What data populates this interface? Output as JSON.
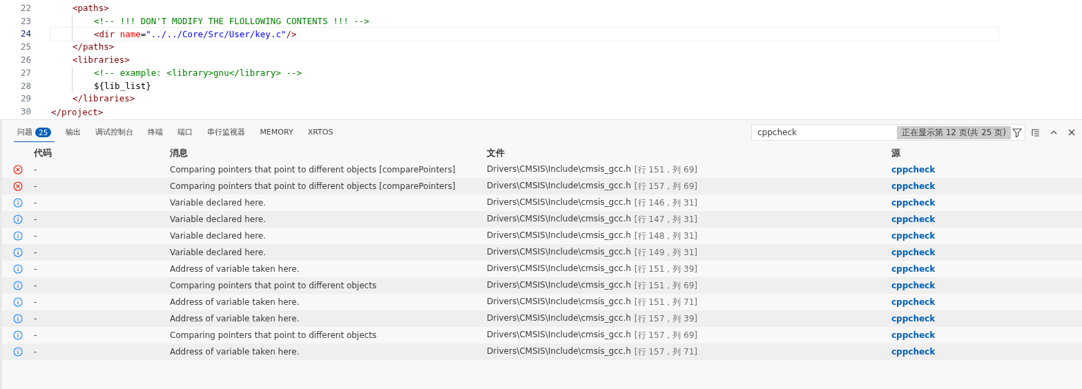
{
  "editor": {
    "lines": [
      {
        "children": [
          {
            "number": "22",
            "current": false,
            "tokens": [
              {
                "kind": "tag",
                "text": "<paths>"
              }
            ],
            "children": [
              {
                "number": "23",
                "current": false,
                "tokens": [
                  {
                    "kind": "comment",
                    "text": "<!-- !!! DON'T MODIFY THE FLOLLOWING CONTENTS !!! -->"
                  }
                ]
              },
              {
                "number": "24",
                "current": true,
                "tokens": [
                  {
                    "kind": "tag",
                    "text": "<dir "
                  },
                  {
                    "kind": "attr",
                    "text": "name"
                  },
                  {
                    "kind": "text",
                    "text": "="
                  },
                  {
                    "kind": "string",
                    "text": "\"../../Core/Src/User/key.c\""
                  },
                  {
                    "kind": "tag",
                    "text": "/>"
                  }
                ]
              }
            ]
          },
          {
            "number": "25",
            "current": false,
            "tokens": [
              {
                "kind": "tag",
                "text": "</paths>"
              }
            ]
          },
          {
            "number": "26",
            "current": false,
            "tokens": [
              {
                "kind": "tag",
                "text": "<libraries>"
              }
            ],
            "children": [
              {
                "number": "27",
                "current": false,
                "tokens": [
                  {
                    "kind": "comment",
                    "text": "<!-- example: <library>gnu</library> -->"
                  }
                ]
              },
              {
                "number": "28",
                "current": false,
                "tokens": [
                  {
                    "kind": "text",
                    "text": "${lib_list}"
                  }
                ]
              }
            ]
          },
          {
            "number": "29",
            "current": false,
            "tokens": [
              {
                "kind": "tag",
                "text": "</libraries>"
              }
            ]
          }
        ]
      },
      {
        "number": "30",
        "current": false,
        "tokens": [
          {
            "kind": "tag",
            "text": "</project>"
          }
        ]
      }
    ]
  },
  "panel": {
    "tabs": [
      {
        "label": "问题",
        "badge": "25",
        "selected": true
      },
      {
        "label": "输出",
        "selected": false
      },
      {
        "label": "调试控制台",
        "selected": false
      },
      {
        "label": "终端",
        "selected": false
      },
      {
        "label": "端口",
        "selected": false
      },
      {
        "label": "串行监视器",
        "selected": false
      },
      {
        "label": "MEMORY",
        "selected": false
      },
      {
        "label": "XRTOS",
        "selected": false
      }
    ],
    "filter": {
      "value": "cppcheck",
      "page_info": "正在显示第 12 页(共 25 页)"
    },
    "table": {
      "columns": [
        "代码",
        "消息",
        "文件",
        "源"
      ],
      "rows": [
        {
          "kind": "error",
          "code": "-",
          "message": "Comparing pointers that point to different objects [comparePointers]",
          "file": "Drivers\\CMSIS\\Include\\cmsis_gcc.h",
          "location": "[行 151，列 69]",
          "source": "cppcheck"
        },
        {
          "kind": "error",
          "code": "-",
          "message": "Comparing pointers that point to different objects [comparePointers]",
          "file": "Drivers\\CMSIS\\Include\\cmsis_gcc.h",
          "location": "[行 157，列 69]",
          "source": "cppcheck"
        },
        {
          "kind": "info",
          "code": "-",
          "message": "Variable declared here.",
          "file": "Drivers\\CMSIS\\Include\\cmsis_gcc.h",
          "location": "[行 146，列 31]",
          "source": "cppcheck"
        },
        {
          "kind": "info",
          "code": "-",
          "message": "Variable declared here.",
          "file": "Drivers\\CMSIS\\Include\\cmsis_gcc.h",
          "location": "[行 147，列 31]",
          "source": "cppcheck"
        },
        {
          "kind": "info",
          "code": "-",
          "message": "Variable declared here.",
          "file": "Drivers\\CMSIS\\Include\\cmsis_gcc.h",
          "location": "[行 148，列 31]",
          "source": "cppcheck"
        },
        {
          "kind": "info",
          "code": "-",
          "message": "Variable declared here.",
          "file": "Drivers\\CMSIS\\Include\\cmsis_gcc.h",
          "location": "[行 149，列 31]",
          "source": "cppcheck"
        },
        {
          "kind": "info",
          "code": "-",
          "message": "Address of variable taken here.",
          "file": "Drivers\\CMSIS\\Include\\cmsis_gcc.h",
          "location": "[行 151，列 39]",
          "source": "cppcheck"
        },
        {
          "kind": "info",
          "code": "-",
          "message": "Comparing pointers that point to different objects",
          "file": "Drivers\\CMSIS\\Include\\cmsis_gcc.h",
          "location": "[行 151，列 69]",
          "source": "cppcheck"
        },
        {
          "kind": "info",
          "code": "-",
          "message": "Address of variable taken here.",
          "file": "Drivers\\CMSIS\\Include\\cmsis_gcc.h",
          "location": "[行 151，列 71]",
          "source": "cppcheck"
        },
        {
          "kind": "info",
          "code": "-",
          "message": "Address of variable taken here.",
          "file": "Drivers\\CMSIS\\Include\\cmsis_gcc.h",
          "location": "[行 157，列 39]",
          "source": "cppcheck"
        },
        {
          "kind": "info",
          "code": "-",
          "message": "Comparing pointers that point to different objects",
          "file": "Drivers\\CMSIS\\Include\\cmsis_gcc.h",
          "location": "[行 157，列 69]",
          "source": "cppcheck"
        },
        {
          "kind": "info",
          "code": "-",
          "message": "Address of variable taken here.",
          "file": "Drivers\\CMSIS\\Include\\cmsis_gcc.h",
          "location": "[行 157，列 71]",
          "source": "cppcheck"
        }
      ]
    }
  }
}
